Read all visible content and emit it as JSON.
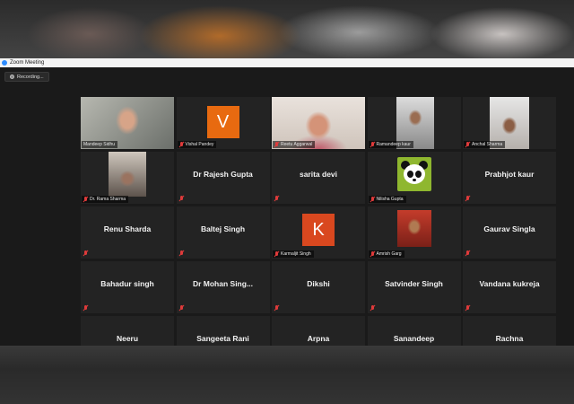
{
  "window": {
    "title": "Zoom Meeting"
  },
  "recording": {
    "label": "Recording..."
  },
  "colors": {
    "active_speaker": "#9be02a",
    "avatar_v": "#e86a10",
    "avatar_k": "#d9481f",
    "muted": "#e03b3b"
  },
  "participants": [
    {
      "name": "Mandeep Sidhu",
      "kind": "video",
      "active": true,
      "muted": false
    },
    {
      "name": "Vishal Pandey",
      "kind": "avatar",
      "letter": "V",
      "muted": true
    },
    {
      "name": "Reetu Aggarwal",
      "kind": "video",
      "muted": true
    },
    {
      "name": "Ramandeep kaur",
      "kind": "video",
      "muted": true
    },
    {
      "name": "Anchal Sharma",
      "kind": "video",
      "muted": true
    },
    {
      "name": "Dr. Rama Sharma",
      "kind": "video",
      "muted": true
    },
    {
      "name": "Dr Rajesh Gupta",
      "kind": "name",
      "muted": true
    },
    {
      "name": "sarita devi",
      "kind": "name",
      "muted": true
    },
    {
      "name": "Nilisha Gupta",
      "kind": "image",
      "icon": "panda-icon",
      "muted": true
    },
    {
      "name": "Prabhjot kaur",
      "kind": "name",
      "muted": true
    },
    {
      "name": "Renu Sharda",
      "kind": "name",
      "muted": true
    },
    {
      "name": "Baltej Singh",
      "kind": "name",
      "muted": true
    },
    {
      "name": "Karmaljit Singh",
      "kind": "avatar",
      "letter": "K",
      "muted": true
    },
    {
      "name": "Amrish Garg",
      "kind": "video",
      "muted": true
    },
    {
      "name": "Gaurav Singla",
      "kind": "name",
      "muted": true
    },
    {
      "name": "Bahadur singh",
      "kind": "name",
      "muted": true
    },
    {
      "name": "Dr Mohan Sing...",
      "kind": "name",
      "muted": true
    },
    {
      "name": "Dikshi",
      "kind": "name",
      "muted": true
    },
    {
      "name": "Satvinder Singh",
      "kind": "name",
      "muted": true
    },
    {
      "name": "Vandana kukreja",
      "kind": "name",
      "muted": true
    },
    {
      "name": "Neeru",
      "kind": "name",
      "muted": true
    },
    {
      "name": "Sangeeta Rani",
      "kind": "name",
      "muted": true
    },
    {
      "name": "Arpna",
      "kind": "name",
      "muted": true
    },
    {
      "name": "Sanandeep",
      "kind": "name",
      "muted": true
    },
    {
      "name": "Rachna",
      "kind": "name",
      "muted": true
    }
  ]
}
